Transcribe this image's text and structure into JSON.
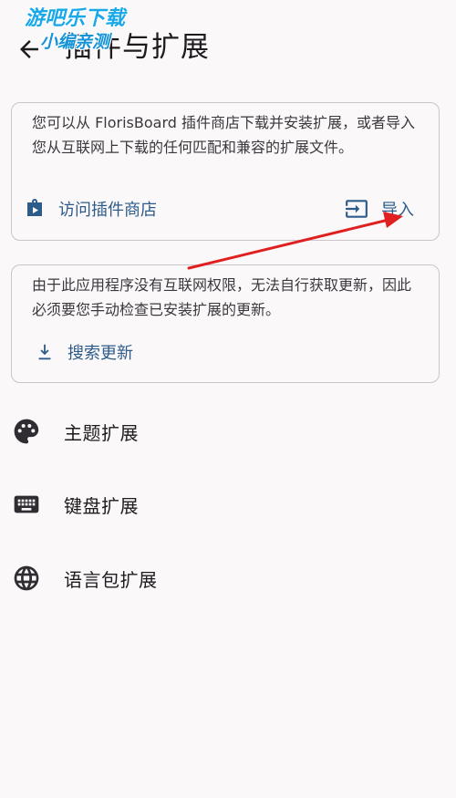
{
  "header": {
    "title": "插件与扩展",
    "watermark_line1": "游吧乐下载",
    "watermark_line2": "小编亲测"
  },
  "cards": {
    "plugin_store": {
      "description": "您可以从 FlorisBoard 插件商店下载并安装扩展，或者导入您从互联网上下载的任何匹配和兼容的扩展文件。",
      "visit_store_label": "访问插件商店",
      "import_label": "导入"
    },
    "updates": {
      "description": "由于此应用程序没有互联网权限，无法自行获取更新，因此必须要您手动检查已安装扩展的更新。",
      "search_updates_label": "搜索更新"
    }
  },
  "list": {
    "items": [
      {
        "label": "主题扩展",
        "icon": "palette-icon"
      },
      {
        "label": "键盘扩展",
        "icon": "keyboard-icon"
      },
      {
        "label": "语言包扩展",
        "icon": "globe-icon"
      }
    ]
  },
  "colors": {
    "accent": "#2e5c8a",
    "background": "#fbf8fa",
    "card_border": "#c9c5cb",
    "annotation_arrow": "#e02020",
    "watermark": "#19a8e8"
  }
}
